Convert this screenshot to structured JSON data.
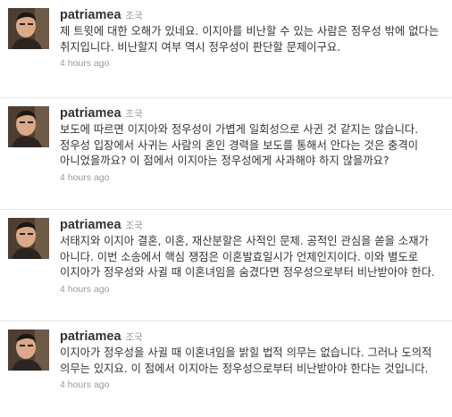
{
  "tweets": [
    {
      "username": "patriamea",
      "realname": "조국",
      "text": "제 트윗에 대한 오해가 있네요. 이지아를 비난할 수 있는 사람은 정우성 밖에 없다는 취지입니다. 비난할지 여부 역시 정우성이 판단할 문제이구요.",
      "time": "4 hours ago"
    },
    {
      "username": "patriamea",
      "realname": "조국",
      "text": "보도에 따르면 이지아와 정우성이 가볍게 일회성으로 사귄 것 같지는 않습니다. 정우성 입장에서 사귀는 사람의 혼인 경력을 보도를 통해서 안다는 것은 충격이 아니었을까요? 이 점에서 이지아는 정우성에게 사과해야 하지 않을까요?",
      "time": "4 hours ago"
    },
    {
      "username": "patriamea",
      "realname": "조국",
      "text": "서태지와 이지아 결혼, 이혼, 재산분할은 사적인 문제. 공적인 관심을 쏟을 소재가 아니다. 이번 소송에서 핵심 쟁점은 이혼발효일시가 언제인지이다. 이와 별도로 이지아가 정우성와 사귈 때 이혼녀임을 숨겼다면 정우성으로부터 비난받아야 한다.",
      "time": "4 hours ago"
    },
    {
      "username": "patriamea",
      "realname": "조국",
      "text": "이지아가 정우성을 사귈 때 이혼녀임을 밝힐 법적 의무는 없습니다. 그러나 도의적 의무는 있지요. 이 점에서 이지아는 정우성으로부터 비난받아야 한다는 것입니다.",
      "time": "4 hours ago"
    }
  ]
}
